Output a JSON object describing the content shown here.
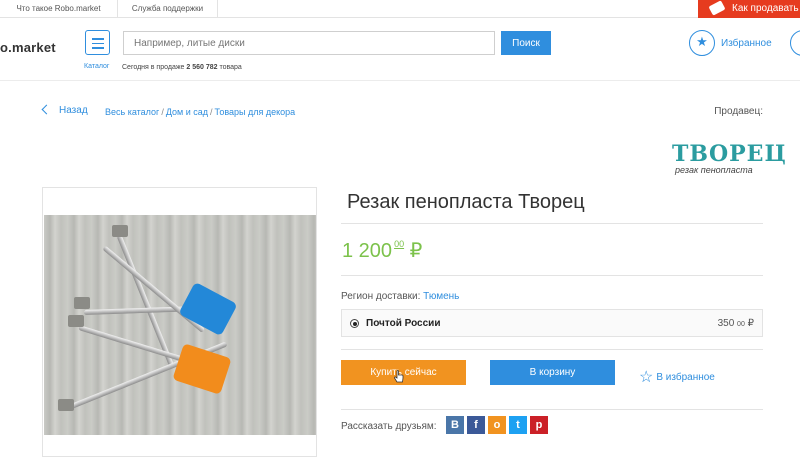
{
  "topbar": {
    "links": [
      "Что такое Robo.market",
      "Служба поддержки"
    ],
    "sell_label": "Как продавать"
  },
  "header": {
    "logo_text": "o.market",
    "catalog_label": "Каталог",
    "search_placeholder": "Например, литые диски",
    "search_button": "Поиск",
    "sale_prefix": "Сегодня в продаже",
    "sale_count": "2 560 782",
    "sale_suffix": "товара",
    "favorites_label": "Избранное"
  },
  "breadcrumbs": {
    "back_label": "Назад",
    "items": [
      "Весь каталог",
      "Дом и сад",
      "Товары для декора"
    ]
  },
  "seller": {
    "label": "Продавец:",
    "brand_name": "ТВОРЕЦ",
    "brand_tagline": "резак пенопласта"
  },
  "product": {
    "title": "Резак пенопласта Творец",
    "price_main": "1 200",
    "price_cents": "00",
    "currency": "₽",
    "region_label": "Регион доставки:",
    "region_value": "Тюмень",
    "delivery": {
      "name": "Почтой России",
      "price": "350",
      "price_cents": "00",
      "currency": "₽"
    },
    "buy_label": "Купить сейчас",
    "cart_label": "В корзину",
    "wishlist_label": "В избранное",
    "share_label": "Рассказать друзьям:"
  },
  "social": [
    {
      "name": "vk",
      "glyph": "В",
      "color": "#4a76a8"
    },
    {
      "name": "facebook",
      "glyph": "f",
      "color": "#3b5998"
    },
    {
      "name": "odnoklassniki",
      "glyph": "о",
      "color": "#f19320"
    },
    {
      "name": "twitter",
      "glyph": "t",
      "color": "#1da1f2"
    },
    {
      "name": "pinterest",
      "glyph": "p",
      "color": "#cb2027"
    }
  ],
  "colors": {
    "accent_blue": "#2f8ede",
    "price_green": "#7cc24b",
    "buy_orange": "#f19320",
    "brand_red": "#e63b1f"
  }
}
